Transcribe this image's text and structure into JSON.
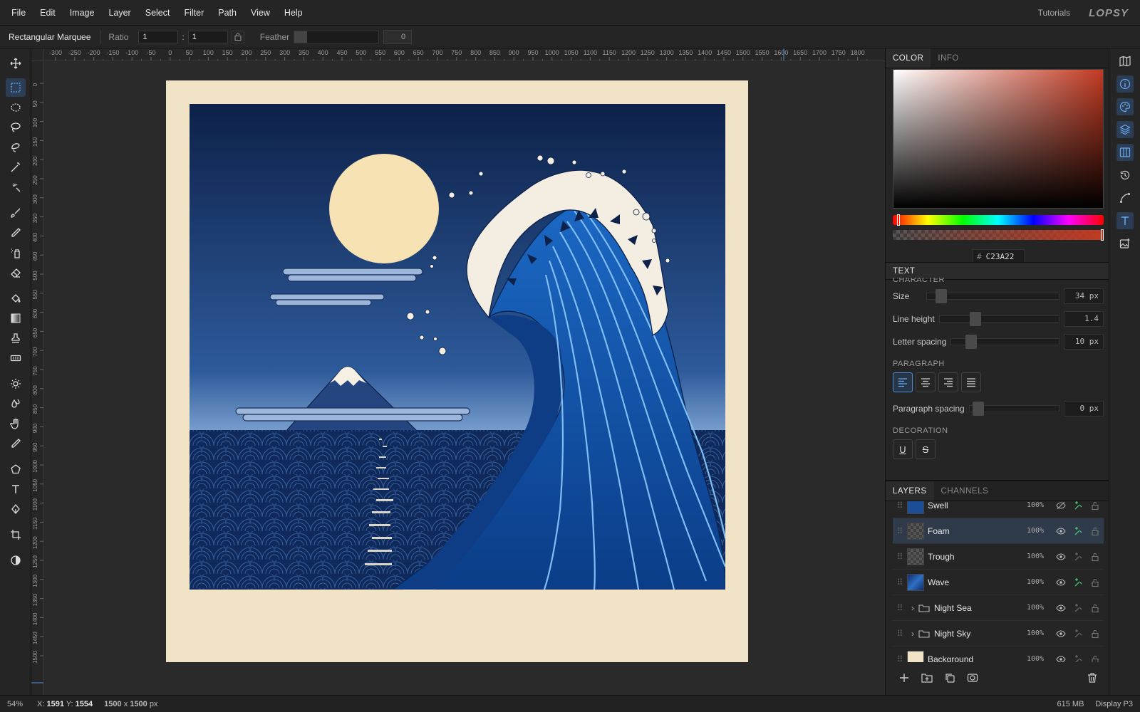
{
  "menubar": {
    "items": [
      "File",
      "Edit",
      "Image",
      "Layer",
      "Select",
      "Filter",
      "Path",
      "View",
      "Help"
    ],
    "tutorials": "Tutorials",
    "logo": "LOPSY"
  },
  "options": {
    "tool_name": "Rectangular Marquee",
    "ratio_label": "Ratio",
    "ratio_w": "1",
    "ratio_sep": ":",
    "ratio_h": "1",
    "feather_label": "Feather",
    "feather_value": "0"
  },
  "rulers": {
    "top_ticks": [
      "-300",
      "-250",
      "-200",
      "-150",
      "-100",
      "-50",
      "0",
      "50",
      "100",
      "150",
      "200",
      "250",
      "300",
      "350",
      "400",
      "450",
      "500",
      "550",
      "600",
      "650",
      "700",
      "750",
      "800",
      "850",
      "900",
      "950",
      "1000",
      "1050",
      "1100",
      "1150",
      "1200",
      "1250",
      "1300",
      "1350",
      "1400",
      "1450",
      "1500",
      "1550",
      "1600",
      "1650",
      "1700",
      "1750",
      "1800"
    ],
    "left_ticks": [
      "0",
      "50",
      "100",
      "150",
      "200",
      "250",
      "300",
      "350",
      "400",
      "450",
      "500",
      "550",
      "600",
      "650",
      "700",
      "750",
      "800",
      "850",
      "900",
      "950",
      "1000",
      "1050",
      "1100",
      "1150",
      "1200",
      "1250",
      "1300",
      "1350",
      "1400",
      "1450",
      "1500"
    ]
  },
  "status": {
    "zoom": "54%",
    "x_label": "X:",
    "x_value": "1591",
    "y_label": "Y:",
    "y_value": "1554",
    "doc_w": "1500",
    "doc_x": "x",
    "doc_h": "1500",
    "doc_unit": "px",
    "memory": "615 MB",
    "color_profile": "Display P3"
  },
  "color_panel": {
    "tabs": [
      "COLOR",
      "INFO"
    ],
    "active_tab": "COLOR",
    "hex_prefix": "#",
    "hex_value": "C23A22",
    "current_color": "#c23a22"
  },
  "text_panel": {
    "title": "TEXT",
    "partial_section": "CHARACTER",
    "size_label": "Size",
    "size_value": "34 px",
    "line_height_label": "Line height",
    "line_height_value": "1.4",
    "letter_spacing_label": "Letter spacing",
    "letter_spacing_value": "10 px",
    "paragraph_header": "PARAGRAPH",
    "paragraph_spacing_label": "Paragraph spacing",
    "paragraph_spacing_value": "0 px",
    "decoration_header": "DECORATION",
    "underline_label": "U",
    "strike_label": "S"
  },
  "layers_panel": {
    "tabs": [
      "LAYERS",
      "CHANNELS"
    ],
    "active_tab": "LAYERS",
    "layers": [
      {
        "name": "Swell",
        "opacity": "100%"
      },
      {
        "name": "Foam",
        "opacity": "100%"
      },
      {
        "name": "Trough",
        "opacity": "100%"
      },
      {
        "name": "Wave",
        "opacity": "100%"
      },
      {
        "name": "Night Sea",
        "opacity": "100%"
      },
      {
        "name": "Night Sky",
        "opacity": "100%"
      },
      {
        "name": "Background",
        "opacity": "100%"
      }
    ]
  },
  "accent_color": "#4a8fd6"
}
